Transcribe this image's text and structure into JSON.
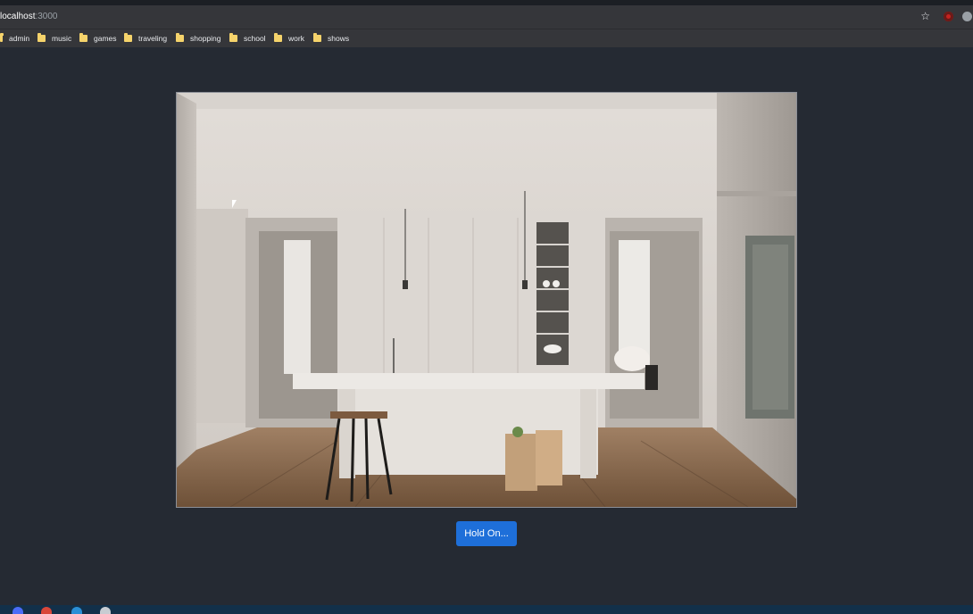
{
  "browser": {
    "url_host": "localhost",
    "url_port": ":3000",
    "icons": [
      "star-icon",
      "extension-icon",
      "profile-icon"
    ]
  },
  "bookmarks": [
    {
      "label": "admin",
      "icon": "folder-icon"
    },
    {
      "label": "music",
      "icon": "folder-icon"
    },
    {
      "label": "games",
      "icon": "folder-icon"
    },
    {
      "label": "traveling",
      "icon": "folder-icon"
    },
    {
      "label": "shopping",
      "icon": "folder-icon"
    },
    {
      "label": "school",
      "icon": "folder-icon"
    },
    {
      "label": "work",
      "icon": "folder-icon"
    },
    {
      "label": "shows",
      "icon": "folder-icon"
    }
  ],
  "main": {
    "image_alt": "kitchen-photo",
    "button_label": "Hold On..."
  },
  "colors": {
    "page_background": "#252a33",
    "button": "#1e6fd9",
    "folder": "#f5d36b"
  }
}
